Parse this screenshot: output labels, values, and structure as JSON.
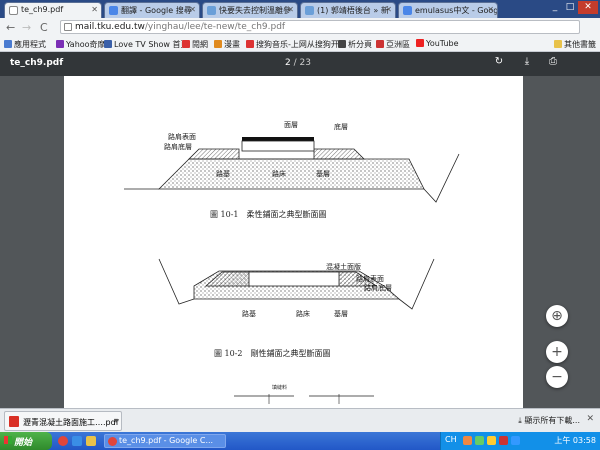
{
  "browser": {
    "tabs": [
      {
        "label": "te_ch9.pdf",
        "active": true,
        "icon": "document-icon"
      },
      {
        "label": "翻譯 - Google 搜尋",
        "active": false,
        "icon": "google-icon"
      },
      {
        "label": "快要失去控制溫離參",
        "active": false,
        "icon": "page-icon"
      },
      {
        "label": "(1) 郭靖梧後台 » 新",
        "active": false,
        "icon": "page-icon"
      },
      {
        "label": "emulasus中文 - Googl",
        "active": false,
        "icon": "google-icon"
      }
    ],
    "window_buttons": {
      "minimize": "_",
      "maximize": "□",
      "close": "✕"
    },
    "nav": {
      "back": "←",
      "forward": "→",
      "reload": "C"
    },
    "url_host": "mail.tku.edu.tw",
    "url_path": "/yinghau/lee/te-new/te_ch9.pdf",
    "bookmarks": [
      {
        "label": "應用程式",
        "color": "#4a7bd0"
      },
      {
        "label": "Yahoo奇摩",
        "color": "#7b2fb5"
      },
      {
        "label": "Love TV Show 首頁",
        "color": "#3a5fa8"
      },
      {
        "label": "閱網",
        "color": "#d33"
      },
      {
        "label": "漫畫",
        "color": "#e08a1e"
      },
      {
        "label": "搜狗音乐-上网从搜狗开",
        "color": "#d33"
      },
      {
        "label": "析分頁",
        "color": "#444"
      },
      {
        "label": "亞洲區",
        "color": "#c33"
      },
      {
        "label": "YouTube",
        "color": "#e22"
      }
    ],
    "other_bookmarks": "其他書籤"
  },
  "pdf": {
    "file_title": "te_ch9.pdf",
    "page_current": "2",
    "page_total": "/ 23",
    "rotate_icon": "rotate-icon",
    "download_icon": "download-icon",
    "print_icon": "print-icon"
  },
  "figure1": {
    "labels": {
      "surface": "面層",
      "base_layer": "底層",
      "shoulder_surface": "路肩表面",
      "shoulder_base": "路肩底層",
      "foundation": "路基",
      "subgrade": "路床",
      "base_course": "基層"
    },
    "caption": "圖 10-1　柔性鋪面之典型斷面圖"
  },
  "figure2": {
    "labels": {
      "slab": "混凝土面版",
      "shoulder_surface": "路肩表面",
      "shoulder_base": "路肩底層",
      "foundation": "路基",
      "subgrade": "路床",
      "base_course": "基層"
    },
    "caption": "圖 10-2　剛性鋪面之典型斷面圖"
  },
  "figure3": {
    "label": "填縫料"
  },
  "zoom": {
    "fit": "⊕",
    "in": "+",
    "out": "−"
  },
  "download_bar": {
    "file": "瀝青混凝土路面施工….pdf",
    "show_all": "顯示所有下載...",
    "close": "✕"
  },
  "taskbar": {
    "start": "開始",
    "windows": [
      {
        "label": "te_ch9.pdf - Google C..."
      }
    ],
    "lang": "CH",
    "clock": "上午 03:58"
  }
}
